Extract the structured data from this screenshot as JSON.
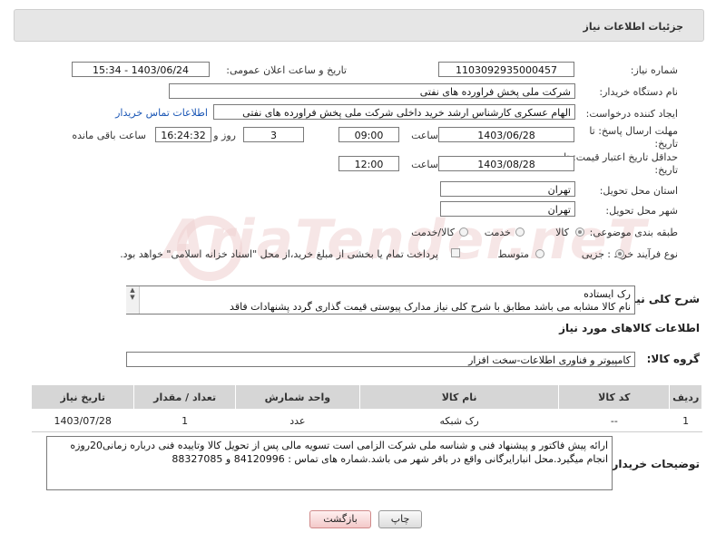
{
  "header": {
    "title": "جزئیات اطلاعات نیاز"
  },
  "fields": {
    "need_number_label": "شماره نیاز:",
    "need_number": "1103092935000457",
    "announce_label": "تاریخ و ساعت اعلان عمومی:",
    "announce_value": "1403/06/24 - 15:34",
    "buyer_org_label": "نام دستگاه خریدار:",
    "buyer_org": "شرکت ملی پخش فراورده های نفتی",
    "creator_label": "ایجاد کننده درخواست:",
    "creator": "الهام عسکری کارشناس ارشد خرید داخلی شرکت ملی پخش فراورده های نفتی",
    "contact_link": "اطلاعات تماس خریدار",
    "deadline_label": "مهلت ارسال پاسخ: تا",
    "deadline_label2": "تاریخ:",
    "deadline_date": "1403/06/28",
    "time_label": "ساعت",
    "deadline_time": "09:00",
    "days_value": "3",
    "days_label": "روز و",
    "remaining_time": "16:24:32",
    "remaining_label": "ساعت باقی مانده",
    "validity_label": "حداقل تاریخ اعتبار قیمت: تا",
    "validity_label2": "تاریخ:",
    "validity_date": "1403/08/28",
    "validity_time": "12:00",
    "province_label": "استان محل تحویل:",
    "province": "تهران",
    "city_label": "شهر محل تحویل:",
    "city": "تهران",
    "category_label": "طبقه بندی موضوعی:",
    "category_options": [
      "کالا",
      "خدمت",
      "کالا/خدمت"
    ],
    "process_label": "نوع فرآیند خرید :",
    "process_options": [
      "جزیی",
      "متوسط"
    ],
    "payment_note": "پرداخت تمام یا بخشی از مبلغ خرید،از محل \"اسناد خزانه اسلامی\" خواهد بود."
  },
  "description": {
    "label": "شرح کلی نیاز:",
    "line1": "رک ایستاده",
    "line2": "نام کالا مشابه می باشد مطابق با شرح کلی نیاز مدارک پیوستی قیمت گذاری گردد پشنهادات فاقد"
  },
  "goods": {
    "section_title": "اطلاعات کالاهای مورد نیاز",
    "group_label": "گروه کالا:",
    "group_value": "کامپیوتر و فناوری اطلاعات-سخت افزار",
    "columns": [
      "ردیف",
      "کد کالا",
      "نام کالا",
      "واحد شمارش",
      "تعداد / مقدار",
      "تاریخ نیاز"
    ],
    "rows": [
      [
        "1",
        "--",
        "رک شبکه",
        "عدد",
        "1",
        "1403/07/28"
      ]
    ]
  },
  "notes": {
    "label": "توضیحات خریدار:",
    "text": "ارائه پیش فاکتور و پیشنهاد فنی و شناسه ملی شرکت الزامی است تسویه مالی پس از تحویل کالا وتاییده فنی درباره زمانی20روزه انجام میگیرد.محل انبارایرگانی واقع در باقر شهر می باشد.شماره های تماس : 84120996 و 88327085"
  },
  "buttons": {
    "print": "چاپ",
    "back": "بازگشت"
  },
  "watermark": "AriaTender.neT"
}
